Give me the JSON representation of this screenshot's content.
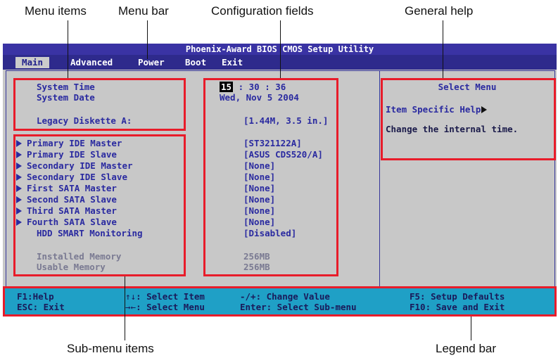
{
  "callouts": {
    "menu_items": "Menu items",
    "menu_bar": "Menu bar",
    "config_fields": "Configuration fields",
    "general_help": "General help",
    "submenu_items": "Sub-menu items",
    "legend_bar": "Legend bar"
  },
  "title": "Phoenix-Award BIOS CMOS Setup Utility",
  "tabs": [
    "Main",
    "Advanced",
    "Power",
    "Boot",
    "Exit"
  ],
  "active_tab": "Main",
  "time": {
    "label": "System Time",
    "hour": "15",
    "rest": " : 30 : 36"
  },
  "date": {
    "label": "System Date",
    "value": "Wed, Nov 5 2004"
  },
  "diskette": {
    "label": "Legacy Diskette A:",
    "value": "[1.44M, 3.5 in.]"
  },
  "submenus": [
    {
      "label": "Primary IDE Master",
      "value": "[ST321122A]"
    },
    {
      "label": "Primary IDE Slave",
      "value": "[ASUS CDS520/A]"
    },
    {
      "label": "Secondary IDE Master",
      "value": "[None]"
    },
    {
      "label": "Secondary IDE Slave",
      "value": "[None]"
    },
    {
      "label": "First SATA Master",
      "value": "[None]"
    },
    {
      "label": "Second SATA Slave",
      "value": "[None]"
    },
    {
      "label": "Third SATA Master",
      "value": "[None]"
    },
    {
      "label": "Fourth SATA Slave",
      "value": "[None]"
    }
  ],
  "smart": {
    "label": "HDD SMART Monitoring",
    "value": "[Disabled]"
  },
  "installed_memory": {
    "label": "Installed Memory",
    "value": "256MB"
  },
  "usable_memory": {
    "label": "Usable Memory",
    "value": "256MB"
  },
  "help": {
    "title": "Select Menu",
    "subtitle": "Item Specific Help",
    "text": "Change the internal time."
  },
  "legend": {
    "f1": "F1:Help",
    "esc": "ESC: Exit",
    "select_item": ": Select Item",
    "select_menu": ": Select Menu",
    "change_value": "-/+: Change Value",
    "select_submenu": "Enter: Select Sub-menu",
    "f5": "F5: Setup Defaults",
    "f10": "F10: Save and Exit"
  },
  "colors": {
    "title_bg": "#3a33a4",
    "panel_bg": "#c8c8c8",
    "text": "#2a2aa0",
    "legend_bg": "#1fa0c6",
    "callout_box": "#e81c2a"
  }
}
